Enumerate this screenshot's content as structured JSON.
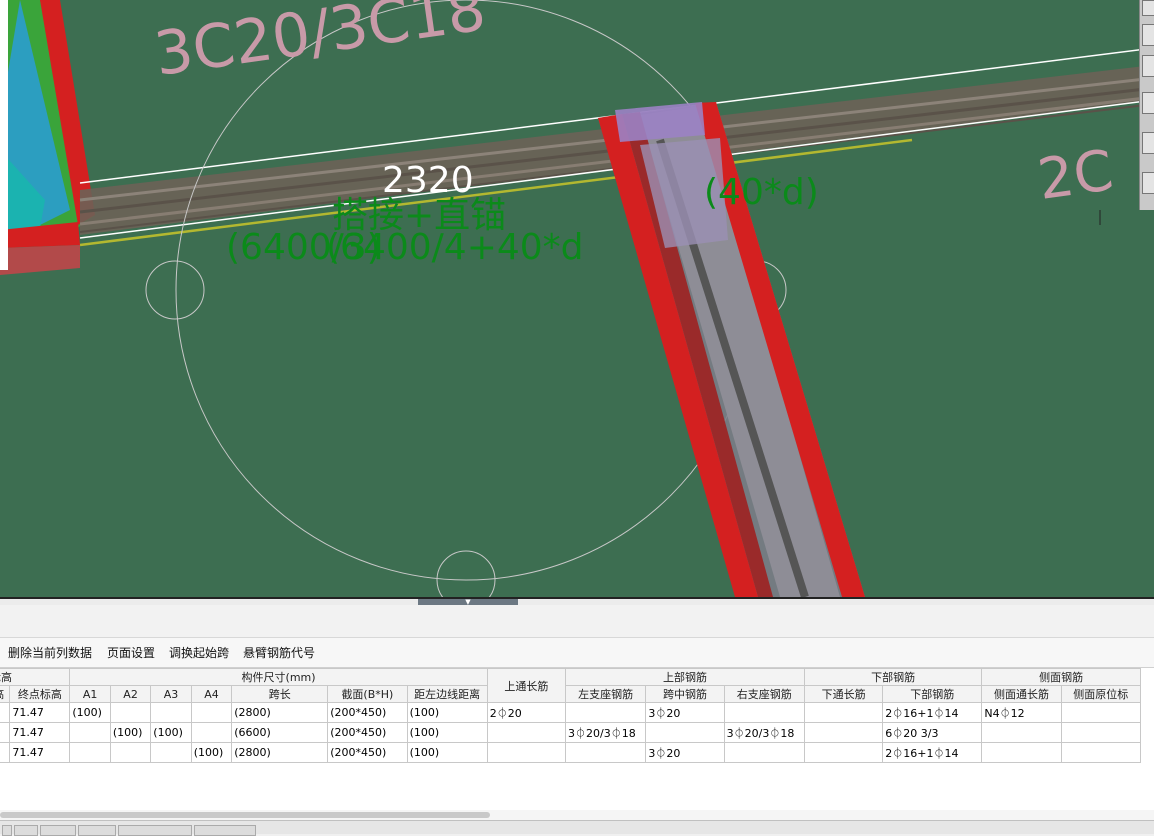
{
  "viewport": {
    "background": "#3d6e51",
    "labels": {
      "rebar_big": "3C20/3C18",
      "rebar_right": "2C",
      "length": "2320",
      "lap": "搭接+直锚",
      "formula_a": "(6400/3)",
      "formula_b": "(6400/4+40*d",
      "anchor": "(40*d)"
    },
    "colors": {
      "beam_edge": "#d42020",
      "label_pink": "#c89aa8",
      "label_green": "#0b8a1a",
      "guide_line": "#b3b830"
    }
  },
  "toolbar": {
    "delete_column": "删除当前列数据",
    "page_setup": "页面设置",
    "swap_start_span": "调换起始跨",
    "cantilever_code": "悬臂钢筋代号"
  },
  "grid": {
    "groups": {
      "elev": "标高",
      "size": "构件尺寸(mm)",
      "top_through": "上通长筋",
      "top": "上部钢筋",
      "bottom": "下部钢筋",
      "side": "侧面钢筋"
    },
    "columns": {
      "start_elev": "高",
      "end_elev": "终点标高",
      "a1": "A1",
      "a2": "A2",
      "a3": "A3",
      "a4": "A4",
      "span": "跨长",
      "section": "截面(B*H)",
      "offset": "距左边线距离",
      "left_support": "左支座钢筋",
      "mid_span": "跨中钢筋",
      "right_support": "右支座钢筋",
      "bottom_through": "下通长筋",
      "bottom_bar": "下部钢筋",
      "side_through": "侧面通长筋",
      "side_local": "侧面原位标"
    },
    "rows": [
      {
        "start": "",
        "end": "71.47",
        "a1": "(100)",
        "a2": "",
        "a3": "",
        "a4": "",
        "span": "(2800)",
        "section": "(200*450)",
        "offset": "(100)",
        "top_through": "2⏀20",
        "left": "",
        "mid": "3⏀20",
        "right": "",
        "bot_through": "",
        "bottom": "2⏀16+1⏀14",
        "side_through": "N4⏀12",
        "side_local": ""
      },
      {
        "start": "",
        "end": "71.47",
        "a1": "",
        "a2": "(100)",
        "a3": "(100)",
        "a4": "",
        "span": "(6600)",
        "section": "(200*450)",
        "offset": "(100)",
        "top_through": "",
        "left": "3⏀20/3⏀18",
        "mid": "",
        "right": "3⏀20/3⏀18",
        "bot_through": "",
        "bottom": "6⏀20 3/3",
        "side_through": "",
        "side_local": ""
      },
      {
        "start": "",
        "end": "71.47",
        "a1": "",
        "a2": "",
        "a3": "",
        "a4": "(100)",
        "span": "(2800)",
        "section": "(200*450)",
        "offset": "(100)",
        "top_through": "",
        "left": "",
        "mid": "3⏀20",
        "right": "",
        "bot_through": "",
        "bottom": "2⏀16+1⏀14",
        "side_through": "",
        "side_local": ""
      }
    ]
  }
}
